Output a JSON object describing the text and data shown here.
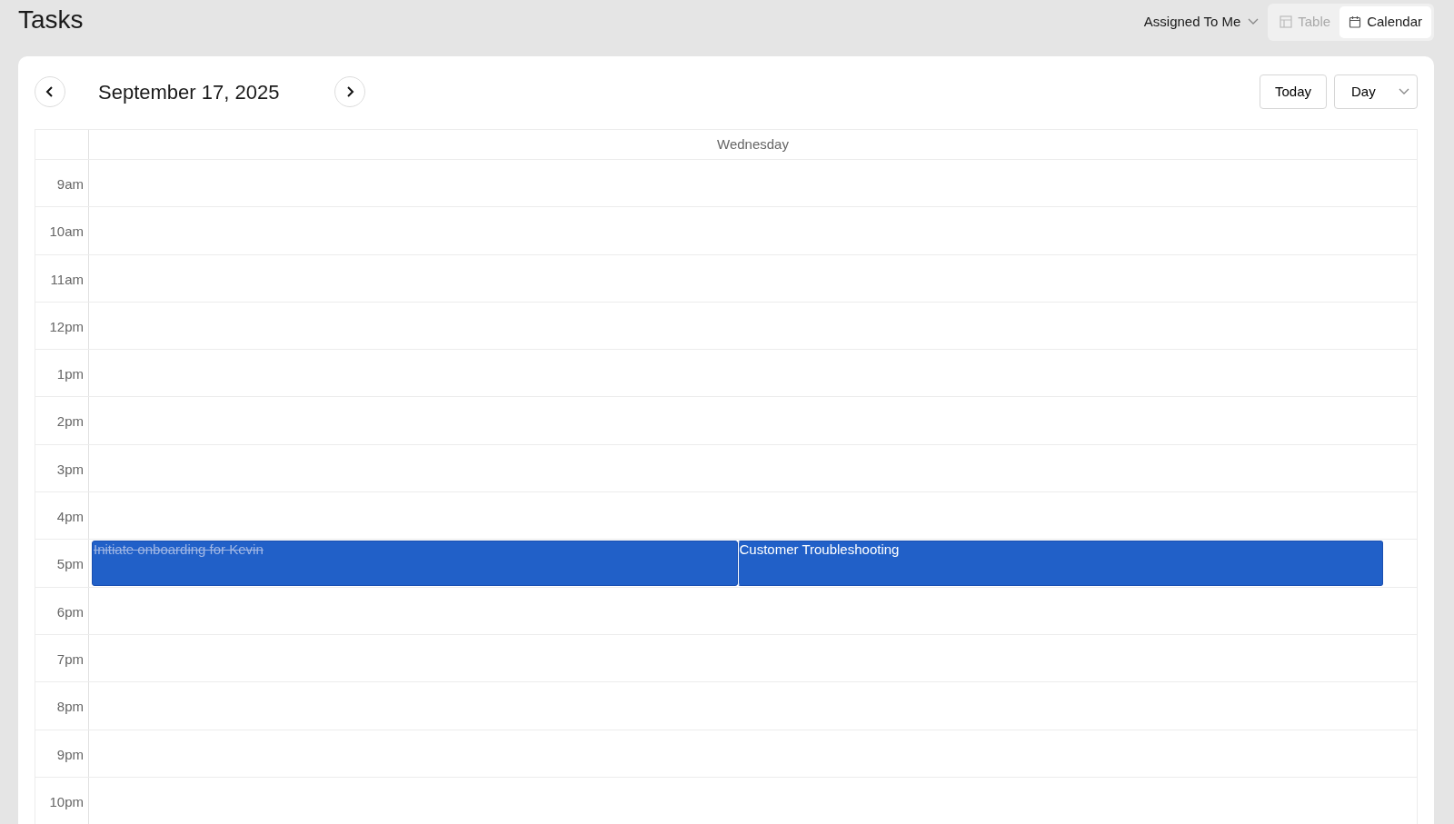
{
  "page": {
    "title": "Tasks"
  },
  "filter": {
    "label": "Assigned To Me"
  },
  "view_tabs": [
    {
      "label": "Table",
      "kind": "table",
      "selected": false
    },
    {
      "label": "Calendar",
      "kind": "calendar",
      "selected": true
    }
  ],
  "calendar": {
    "date": "September 17, 2025",
    "today_button": "Today",
    "range_select": "Day",
    "day_header": "Wednesday",
    "hours": [
      {
        "label": "9am"
      },
      {
        "label": "10am"
      },
      {
        "label": "11am"
      },
      {
        "label": "12pm"
      },
      {
        "label": "1pm"
      },
      {
        "label": "2pm"
      },
      {
        "label": "3pm"
      },
      {
        "label": "4pm"
      },
      {
        "label": "5pm",
        "events": [
          {
            "title": "Initiate onboarding for Kevin",
            "done": true
          },
          {
            "title": "Customer Troubleshooting",
            "done": false
          }
        ]
      },
      {
        "label": "6pm"
      },
      {
        "label": "7pm"
      },
      {
        "label": "8pm"
      },
      {
        "label": "9pm"
      },
      {
        "label": "10pm"
      }
    ]
  }
}
